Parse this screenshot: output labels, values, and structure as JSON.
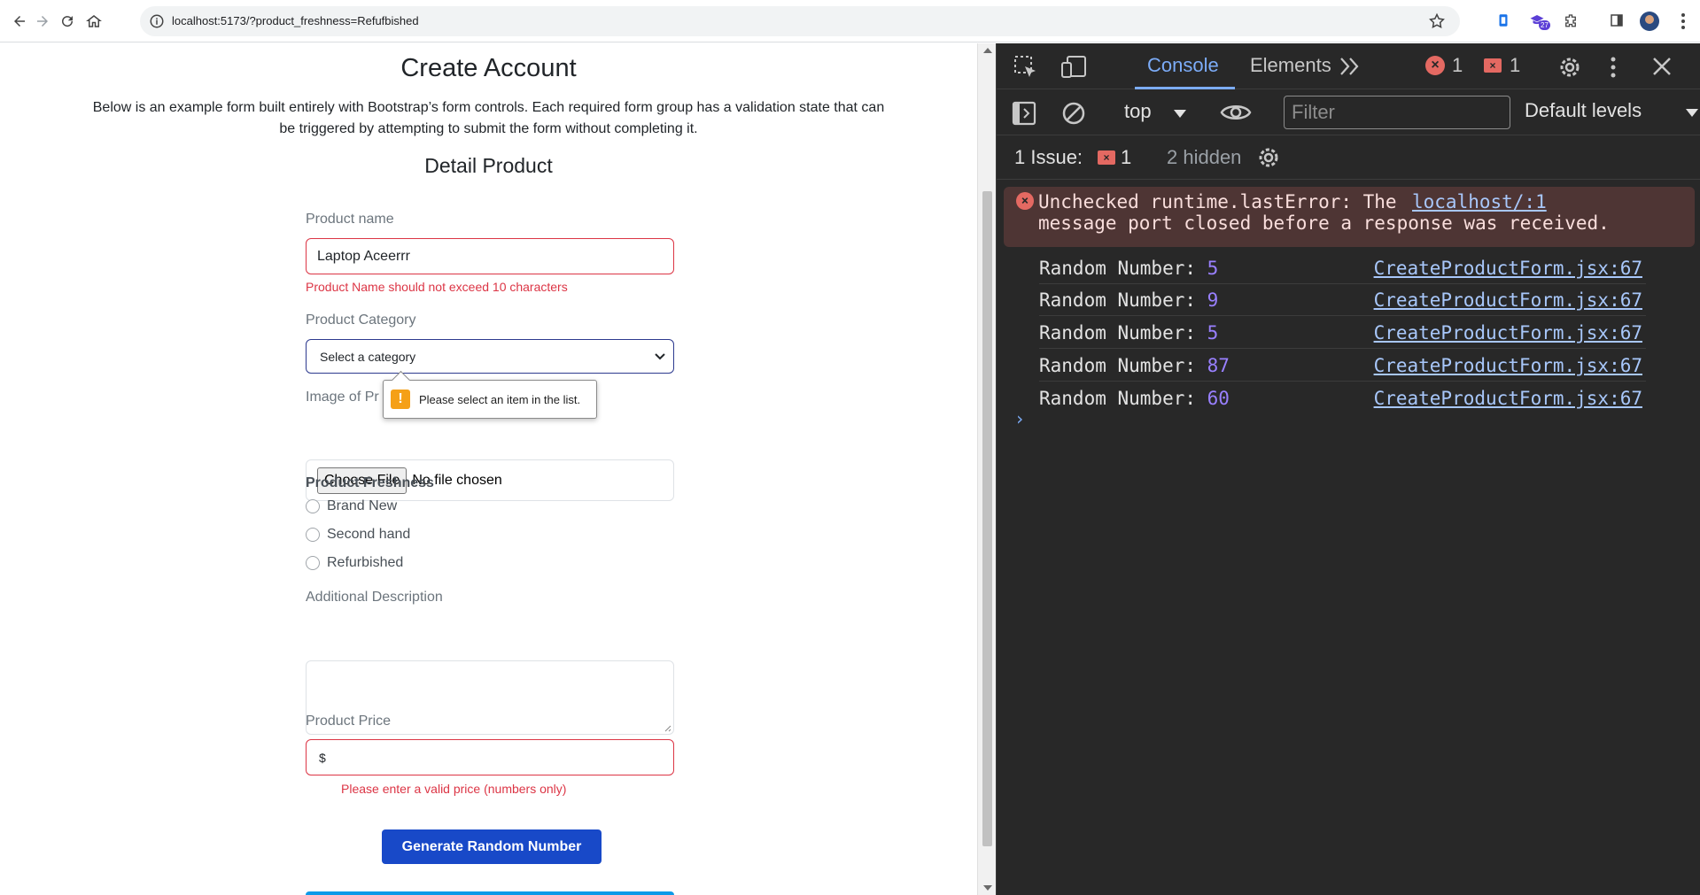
{
  "browser": {
    "url": "localhost:5173/?product_freshness=Refufbished",
    "extension_badge": "27"
  },
  "page": {
    "title": "Create Account",
    "description": "Below is an example form built entirely with Bootstrap’s form controls. Each required form group has a validation state that can be triggered by attempting to submit the form without completing it.",
    "section_title": "Detail Product",
    "product_name": {
      "label": "Product name",
      "value": "Laptop Aceerrr",
      "error": "Product Name should not exceed 10 characters"
    },
    "product_category": {
      "label": "Product Category",
      "selected": "Select a category",
      "tooltip": "Please select an item in the list."
    },
    "product_image": {
      "label": "Image of Pr",
      "button": "Choose File",
      "status": "No file chosen"
    },
    "freshness": {
      "label": "Product Freshness",
      "options": [
        "Brand New",
        "Second hand",
        "Refurbished"
      ]
    },
    "description_field": {
      "label": "Additional Description",
      "value": ""
    },
    "price": {
      "label": "Product Price",
      "value": "$",
      "error": "Please enter a valid price (numbers only)"
    },
    "random_button": "Generate Random Number"
  },
  "devtools": {
    "tabs": [
      "Console",
      "Elements"
    ],
    "active_tab": "Console",
    "error_count": "1",
    "issue_count": "1",
    "context": "top",
    "filter_placeholder": "Filter",
    "levels": "Default levels",
    "issues_label": "1 Issue:",
    "issues_badge": "1",
    "hidden_label": "2 hidden",
    "error_message": {
      "text": "Unchecked runtime.lastError: The\nmessage port closed before a response was received.",
      "source": "localhost/:1"
    },
    "logs": [
      {
        "label": "Random Number: ",
        "value": "5",
        "source": "CreateProductForm.jsx:67"
      },
      {
        "label": "Random Number: ",
        "value": "9",
        "source": "CreateProductForm.jsx:67"
      },
      {
        "label": "Random Number: ",
        "value": "5",
        "source": "CreateProductForm.jsx:67"
      },
      {
        "label": "Random Number: ",
        "value": "87",
        "source": "CreateProductForm.jsx:67"
      },
      {
        "label": "Random Number: ",
        "value": "60",
        "source": "CreateProductForm.jsx:67"
      }
    ],
    "colors": {
      "background": "#282828",
      "active_tab": "#7cacf8",
      "error": "#e46962",
      "number": "#9980ff"
    }
  }
}
